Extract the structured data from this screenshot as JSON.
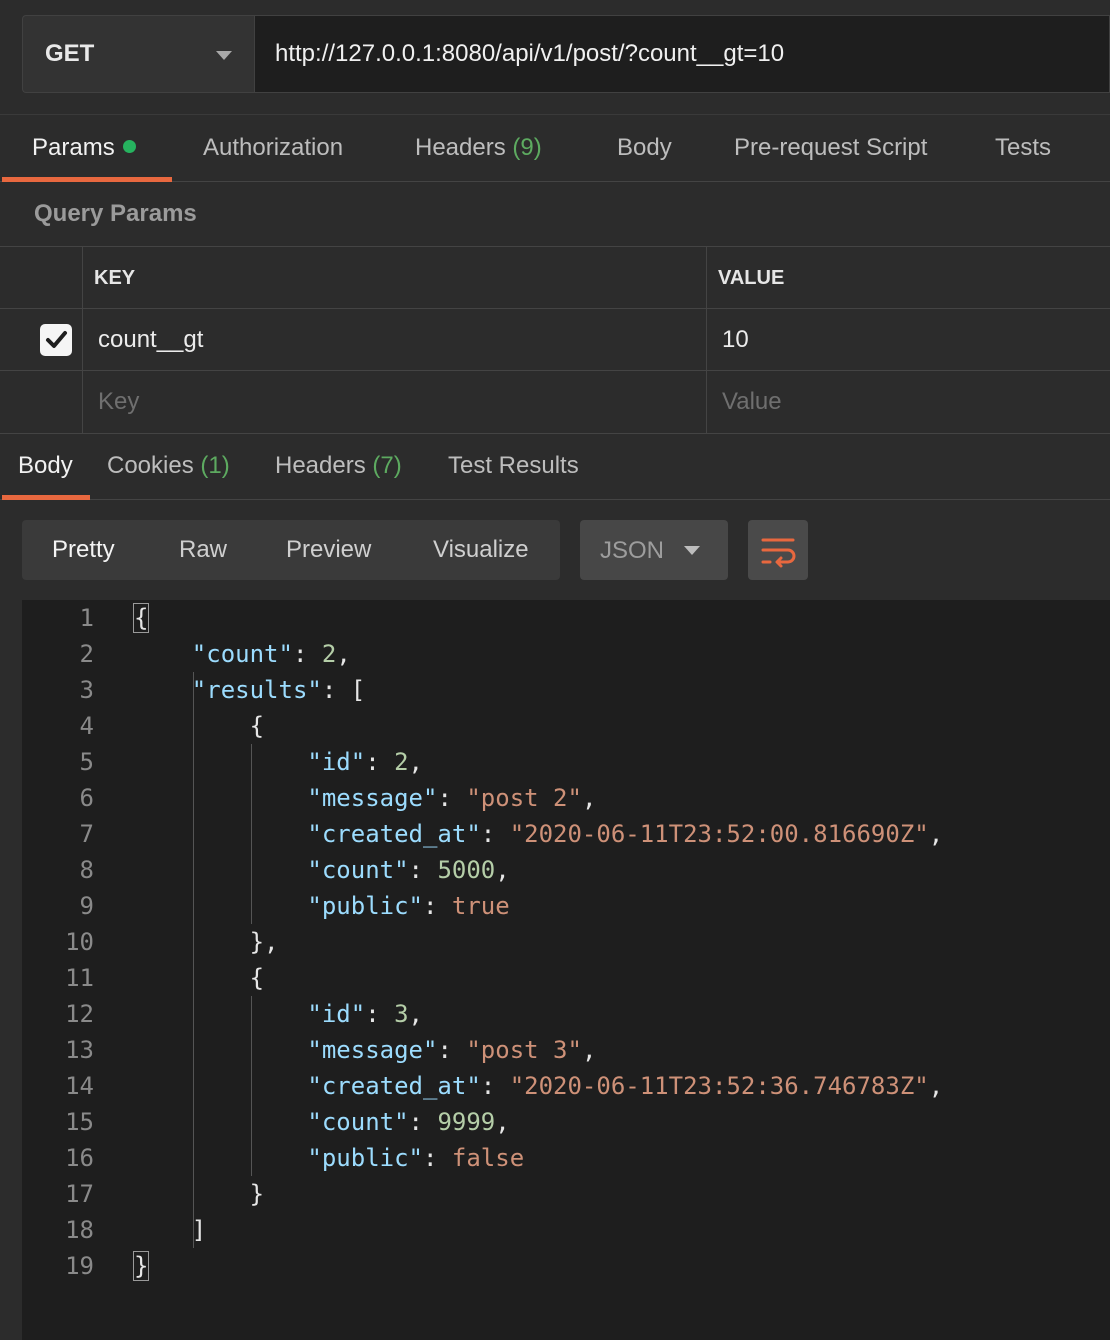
{
  "request": {
    "method": "GET",
    "url": "http://127.0.0.1:8080/api/v1/post/?count__gt=10"
  },
  "request_tabs": [
    {
      "label": "Params",
      "count": ""
    },
    {
      "label": "Authorization",
      "count": ""
    },
    {
      "label": "Headers",
      "count": "(9)"
    },
    {
      "label": "Body",
      "count": ""
    },
    {
      "label": "Pre-request Script",
      "count": ""
    },
    {
      "label": "Tests",
      "count": ""
    }
  ],
  "query_params": {
    "title": "Query Params",
    "headers": {
      "key": "KEY",
      "value": "VALUE"
    },
    "rows": [
      {
        "key": "count__gt",
        "value": "10",
        "checked": true
      }
    ],
    "placeholder": {
      "key": "Key",
      "value": "Value"
    }
  },
  "response_tabs": [
    {
      "label": "Body",
      "count": ""
    },
    {
      "label": "Cookies",
      "count": "(1)"
    },
    {
      "label": "Headers",
      "count": "(7)"
    },
    {
      "label": "Test Results",
      "count": ""
    }
  ],
  "format_buttons": [
    "Pretty",
    "Raw",
    "Preview",
    "Visualize"
  ],
  "format_select": "JSON",
  "wrap_icon": "wrap-lines-icon",
  "colors": {
    "accent": "#e8683f",
    "key": "#9cdcfe",
    "string": "#ce9178",
    "number": "#b5cea8",
    "count": "#5daa60"
  },
  "code_lines": [
    {
      "n": "1",
      "indent": "",
      "key": "",
      "sep": "",
      "val": "",
      "vtype": "",
      "tail": "{"
    },
    {
      "n": "2",
      "indent": "    ",
      "key": "\"count\"",
      "sep": ": ",
      "val": "2",
      "vtype": "n",
      "tail": ","
    },
    {
      "n": "3",
      "indent": "    ",
      "key": "\"results\"",
      "sep": ": ",
      "val": "",
      "vtype": "",
      "tail": "["
    },
    {
      "n": "4",
      "indent": "        ",
      "key": "",
      "sep": "",
      "val": "",
      "vtype": "",
      "tail": "{"
    },
    {
      "n": "5",
      "indent": "            ",
      "key": "\"id\"",
      "sep": ": ",
      "val": "2",
      "vtype": "n",
      "tail": ","
    },
    {
      "n": "6",
      "indent": "            ",
      "key": "\"message\"",
      "sep": ": ",
      "val": "\"post 2\"",
      "vtype": "s",
      "tail": ","
    },
    {
      "n": "7",
      "indent": "            ",
      "key": "\"created_at\"",
      "sep": ": ",
      "val": "\"2020-06-11T23:52:00.816690Z\"",
      "vtype": "s",
      "tail": ","
    },
    {
      "n": "8",
      "indent": "            ",
      "key": "\"count\"",
      "sep": ": ",
      "val": "5000",
      "vtype": "n",
      "tail": ","
    },
    {
      "n": "9",
      "indent": "            ",
      "key": "\"public\"",
      "sep": ": ",
      "val": "true",
      "vtype": "b",
      "tail": ""
    },
    {
      "n": "10",
      "indent": "        ",
      "key": "",
      "sep": "",
      "val": "",
      "vtype": "",
      "tail": "},"
    },
    {
      "n": "11",
      "indent": "        ",
      "key": "",
      "sep": "",
      "val": "",
      "vtype": "",
      "tail": "{"
    },
    {
      "n": "12",
      "indent": "            ",
      "key": "\"id\"",
      "sep": ": ",
      "val": "3",
      "vtype": "n",
      "tail": ","
    },
    {
      "n": "13",
      "indent": "            ",
      "key": "\"message\"",
      "sep": ": ",
      "val": "\"post 3\"",
      "vtype": "s",
      "tail": ","
    },
    {
      "n": "14",
      "indent": "            ",
      "key": "\"created_at\"",
      "sep": ": ",
      "val": "\"2020-06-11T23:52:36.746783Z\"",
      "vtype": "s",
      "tail": ","
    },
    {
      "n": "15",
      "indent": "            ",
      "key": "\"count\"",
      "sep": ": ",
      "val": "9999",
      "vtype": "n",
      "tail": ","
    },
    {
      "n": "16",
      "indent": "            ",
      "key": "\"public\"",
      "sep": ": ",
      "val": "false",
      "vtype": "b",
      "tail": ""
    },
    {
      "n": "17",
      "indent": "        ",
      "key": "",
      "sep": "",
      "val": "",
      "vtype": "",
      "tail": "}"
    },
    {
      "n": "18",
      "indent": "    ",
      "key": "",
      "sep": "",
      "val": "",
      "vtype": "",
      "tail": "]"
    },
    {
      "n": "19",
      "indent": "",
      "key": "",
      "sep": "",
      "val": "",
      "vtype": "",
      "tail": "}"
    }
  ]
}
